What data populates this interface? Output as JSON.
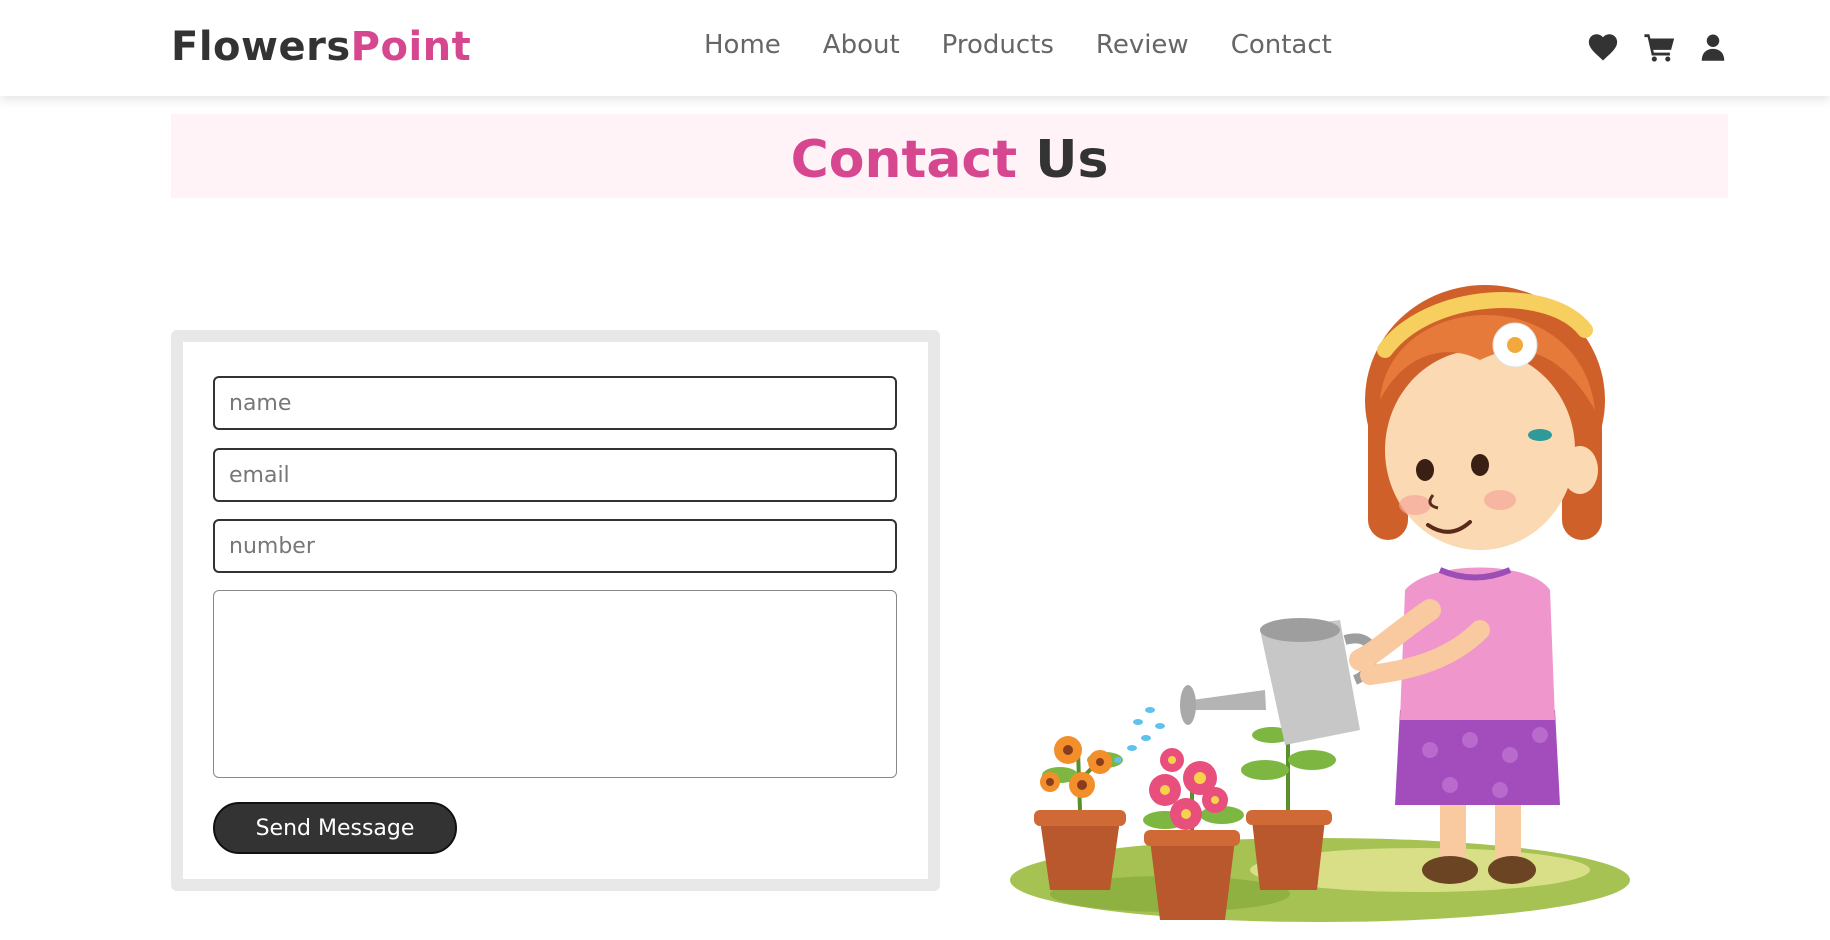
{
  "brand": {
    "name_part1": "Flowers",
    "name_part2": "Point",
    "accent_color": "#d6478f"
  },
  "nav": {
    "links": [
      "Home",
      "About",
      "Products",
      "Review",
      "Contact"
    ],
    "icons": [
      "heart-icon",
      "cart-icon",
      "user-icon"
    ]
  },
  "section": {
    "title_accent": "Contact",
    "title_rest": "Us"
  },
  "form": {
    "name_placeholder": "name",
    "email_placeholder": "email",
    "number_placeholder": "number",
    "message_value": "",
    "submit_label": "Send Message"
  },
  "illustration": {
    "subject": "girl-watering-flowers-illustration"
  }
}
